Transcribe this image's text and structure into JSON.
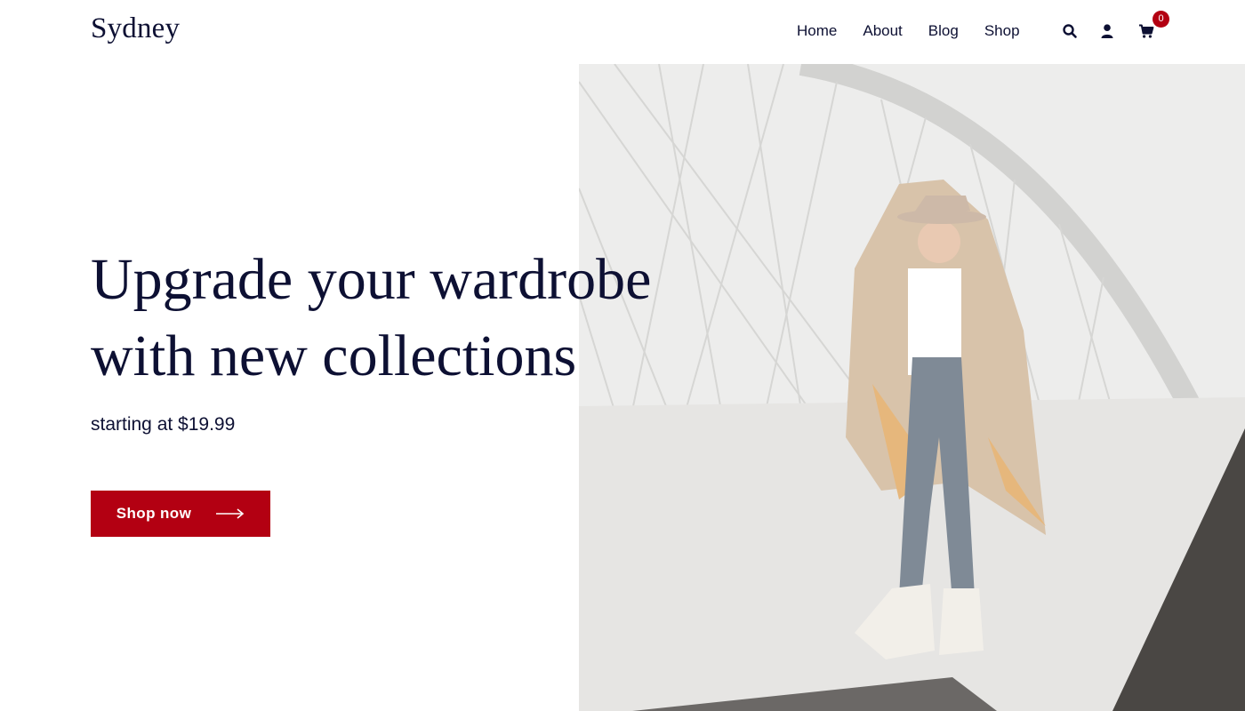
{
  "brand": {
    "name": "Sydney"
  },
  "nav": {
    "items": [
      {
        "label": "Home"
      },
      {
        "label": "About"
      },
      {
        "label": "Blog"
      },
      {
        "label": "Shop"
      }
    ]
  },
  "header_icons": {
    "search": "search-icon",
    "account": "user-icon",
    "cart": "cart-icon",
    "cart_count": "0"
  },
  "hero": {
    "headline_line1": "Upgrade your wardrobe",
    "headline_line2": "with new collections",
    "subline": "starting at $19.99",
    "cta_label": "Shop now",
    "cta_icon": "arrow-right-icon"
  },
  "colors": {
    "accent": "#b30012",
    "text": "#0d1033",
    "background": "#ffffff"
  }
}
